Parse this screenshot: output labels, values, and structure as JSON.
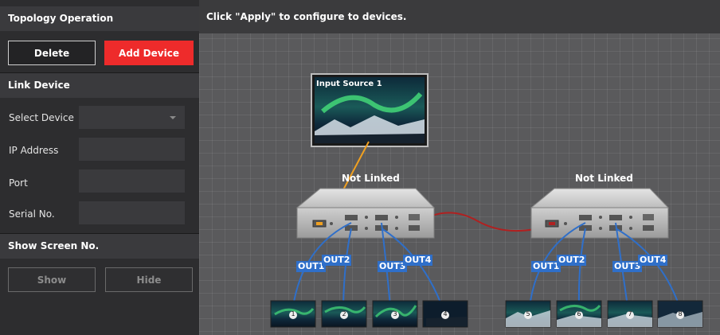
{
  "panel": {
    "topology_title": "Topology Operation",
    "delete_label": "Delete",
    "add_device_label": "Add Device",
    "link_device_title": "Link Device",
    "select_device_label": "Select Device",
    "ip_address_label": "IP Address",
    "port_label": "Port",
    "serial_label": "Serial No.",
    "select_device_value": "",
    "ip_address_value": "",
    "port_value": "",
    "serial_value": "",
    "show_screen_title": "Show Screen No.",
    "show_label": "Show",
    "hide_label": "Hide"
  },
  "canvas": {
    "instruction": "Click \"Apply\" to configure to devices.",
    "input_source_label": "Input Source 1",
    "devices": [
      {
        "status": "Not Linked",
        "outputs": [
          "OUT1",
          "OUT2",
          "OUT3",
          "OUT4"
        ]
      },
      {
        "status": "Not Linked",
        "outputs": [
          "OUT1",
          "OUT2",
          "OUT3",
          "OUT4"
        ]
      }
    ],
    "screens": [
      "1",
      "2",
      "3",
      "4",
      "5",
      "6",
      "7",
      "8"
    ]
  },
  "colors": {
    "add_device_bg": "#ee2b2b",
    "connection_blue": "#2f6fc9",
    "input_cable": "#f0a020",
    "link_cable": "#b02020"
  }
}
